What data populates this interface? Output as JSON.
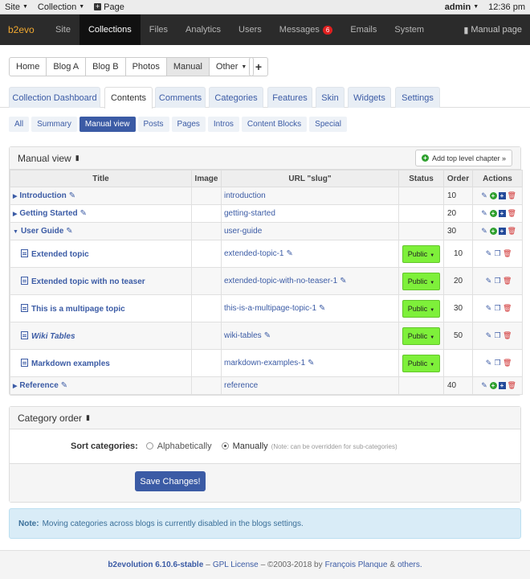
{
  "evobar": {
    "site": "Site",
    "collection": "Collection",
    "page": "Page",
    "user": "admin",
    "time": "12:36 pm"
  },
  "navbar": {
    "brand": "b2evo",
    "items": [
      "Site",
      "Collections",
      "Files",
      "Analytics",
      "Users",
      "Messages",
      "Emails",
      "System"
    ],
    "messages_badge": "6",
    "manual": "Manual page"
  },
  "blogs": {
    "items": [
      "Home",
      "Blog A",
      "Blog B",
      "Photos",
      "Manual",
      "Other"
    ],
    "add": "+"
  },
  "tabs": [
    "Collection Dashboard",
    "Contents",
    "Comments",
    "Categories",
    "Features",
    "Skin",
    "Widgets",
    "Settings"
  ],
  "subtabs": [
    "All",
    "Summary",
    "Manual view",
    "Posts",
    "Pages",
    "Intros",
    "Content Blocks",
    "Special"
  ],
  "manual": {
    "title": "Manual view",
    "add_chapter": "Add top level chapter »",
    "columns": [
      "Title",
      "Image",
      "URL \"slug\"",
      "Status",
      "Order",
      "Actions"
    ],
    "rows": [
      {
        "title": "Introduction",
        "slug": "introduction",
        "status": "",
        "order": "10"
      },
      {
        "title": "Getting Started",
        "slug": "getting-started",
        "status": "",
        "order": "20"
      },
      {
        "title": "User Guide",
        "slug": "user-guide",
        "status": "",
        "order": "30"
      },
      {
        "title": "Extended topic",
        "slug": "extended-topic-1",
        "status": "Public",
        "order": "10"
      },
      {
        "title": "Extended topic with no teaser",
        "slug": "extended-topic-with-no-teaser-1",
        "status": "Public",
        "order": "20"
      },
      {
        "title": "This is a multipage topic",
        "slug": "this-is-a-multipage-topic-1",
        "status": "Public",
        "order": "30"
      },
      {
        "title": "Wiki Tables",
        "slug": "wiki-tables",
        "status": "Public",
        "order": "50"
      },
      {
        "title": "Markdown examples",
        "slug": "markdown-examples-1",
        "status": "Public",
        "order": ""
      },
      {
        "title": "Reference",
        "slug": "reference",
        "status": "",
        "order": "40"
      }
    ]
  },
  "category_order": {
    "title": "Category order",
    "label": "Sort categories:",
    "opt1": "Alphabetically",
    "opt2": "Manually",
    "note": "(Note: can be overridden for sub-categories)",
    "save": "Save Changes!"
  },
  "alert": {
    "label": "Note:",
    "text": "Moving categories across blogs is currently disabled in the blogs settings."
  },
  "footer": {
    "product": "b2evolution 6.10.6-stable",
    "sep1": "–",
    "license": "GPL License",
    "copy": "– ©2003-2018 by",
    "author": "François Planque",
    "amp": "&",
    "others": "others."
  }
}
